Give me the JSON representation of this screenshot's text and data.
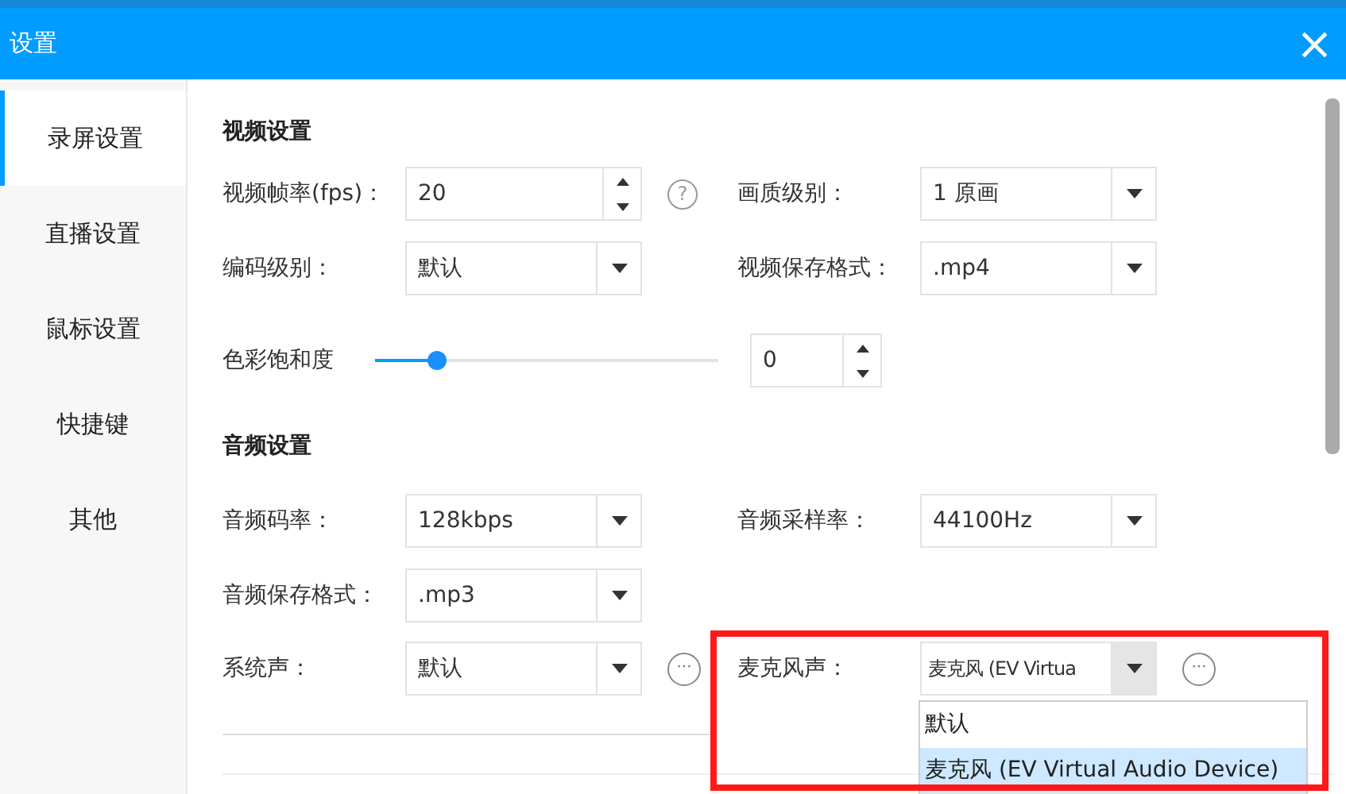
{
  "window": {
    "title": "设置",
    "close": "×"
  },
  "sidebar": {
    "items": [
      {
        "label": "录屏设置",
        "selected": true
      },
      {
        "label": "直播设置",
        "selected": false
      },
      {
        "label": "鼠标设置",
        "selected": false
      },
      {
        "label": "快捷键",
        "selected": false
      },
      {
        "label": "其他",
        "selected": false
      }
    ]
  },
  "video": {
    "heading": "视频设置",
    "fps": {
      "label": "视频帧率(fps)：",
      "value": "20",
      "help": "?"
    },
    "quality": {
      "label": "画质级别：",
      "value": "1 原画"
    },
    "encoding": {
      "label": "编码级别：",
      "value": "默认"
    },
    "format": {
      "label": "视频保存格式：",
      "value": ".mp4"
    },
    "saturation": {
      "label": "色彩饱和度",
      "level": 0.18,
      "value": "0"
    }
  },
  "audio": {
    "heading": "音频设置",
    "bitrate": {
      "label": "音频码率：",
      "value": "128kbps"
    },
    "samplerate": {
      "label": "音频采样率：",
      "value": "44100Hz"
    },
    "format": {
      "label": "音频保存格式：",
      "value": ".mp3"
    },
    "system": {
      "label": "系统声：",
      "value": "默认",
      "more": "···"
    },
    "mic": {
      "label": "麦克风声：",
      "value": "麦克风 (EV Virtua",
      "more": "···",
      "expanded": true,
      "options": [
        {
          "label": "默认",
          "selected": false
        },
        {
          "label": "麦克风 (EV Virtual Audio Device)",
          "selected": true
        }
      ]
    }
  }
}
